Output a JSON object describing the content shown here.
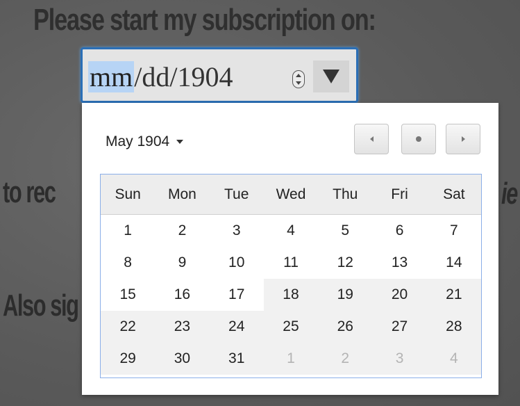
{
  "heading": "Please start my subscription on:",
  "background_fragments": {
    "left_1": "to rec",
    "right_1": "ie",
    "left_2": "Also sig"
  },
  "date_input": {
    "month_placeholder": "mm",
    "separator": "/",
    "day_placeholder": "dd",
    "year_value": "1904",
    "accent_color": "#2b6fb6"
  },
  "calendar": {
    "month_label": "May 1904",
    "nav": {
      "prev_icon": "chevron-left-icon",
      "today_icon": "dot-icon",
      "next_icon": "chevron-right-icon"
    },
    "weekdays": [
      "Sun",
      "Mon",
      "Tue",
      "Wed",
      "Thu",
      "Fri",
      "Sat"
    ],
    "weeks": [
      [
        "1",
        "2",
        "3",
        "4",
        "5",
        "6",
        "7"
      ],
      [
        "8",
        "9",
        "10",
        "11",
        "12",
        "13",
        "14"
      ],
      [
        "15",
        "16",
        "17",
        "18",
        "19",
        "20",
        "21"
      ],
      [
        "22",
        "23",
        "24",
        "25",
        "26",
        "27",
        "28"
      ],
      [
        "29",
        "30",
        "31",
        "1",
        "2",
        "3",
        "4"
      ]
    ]
  }
}
